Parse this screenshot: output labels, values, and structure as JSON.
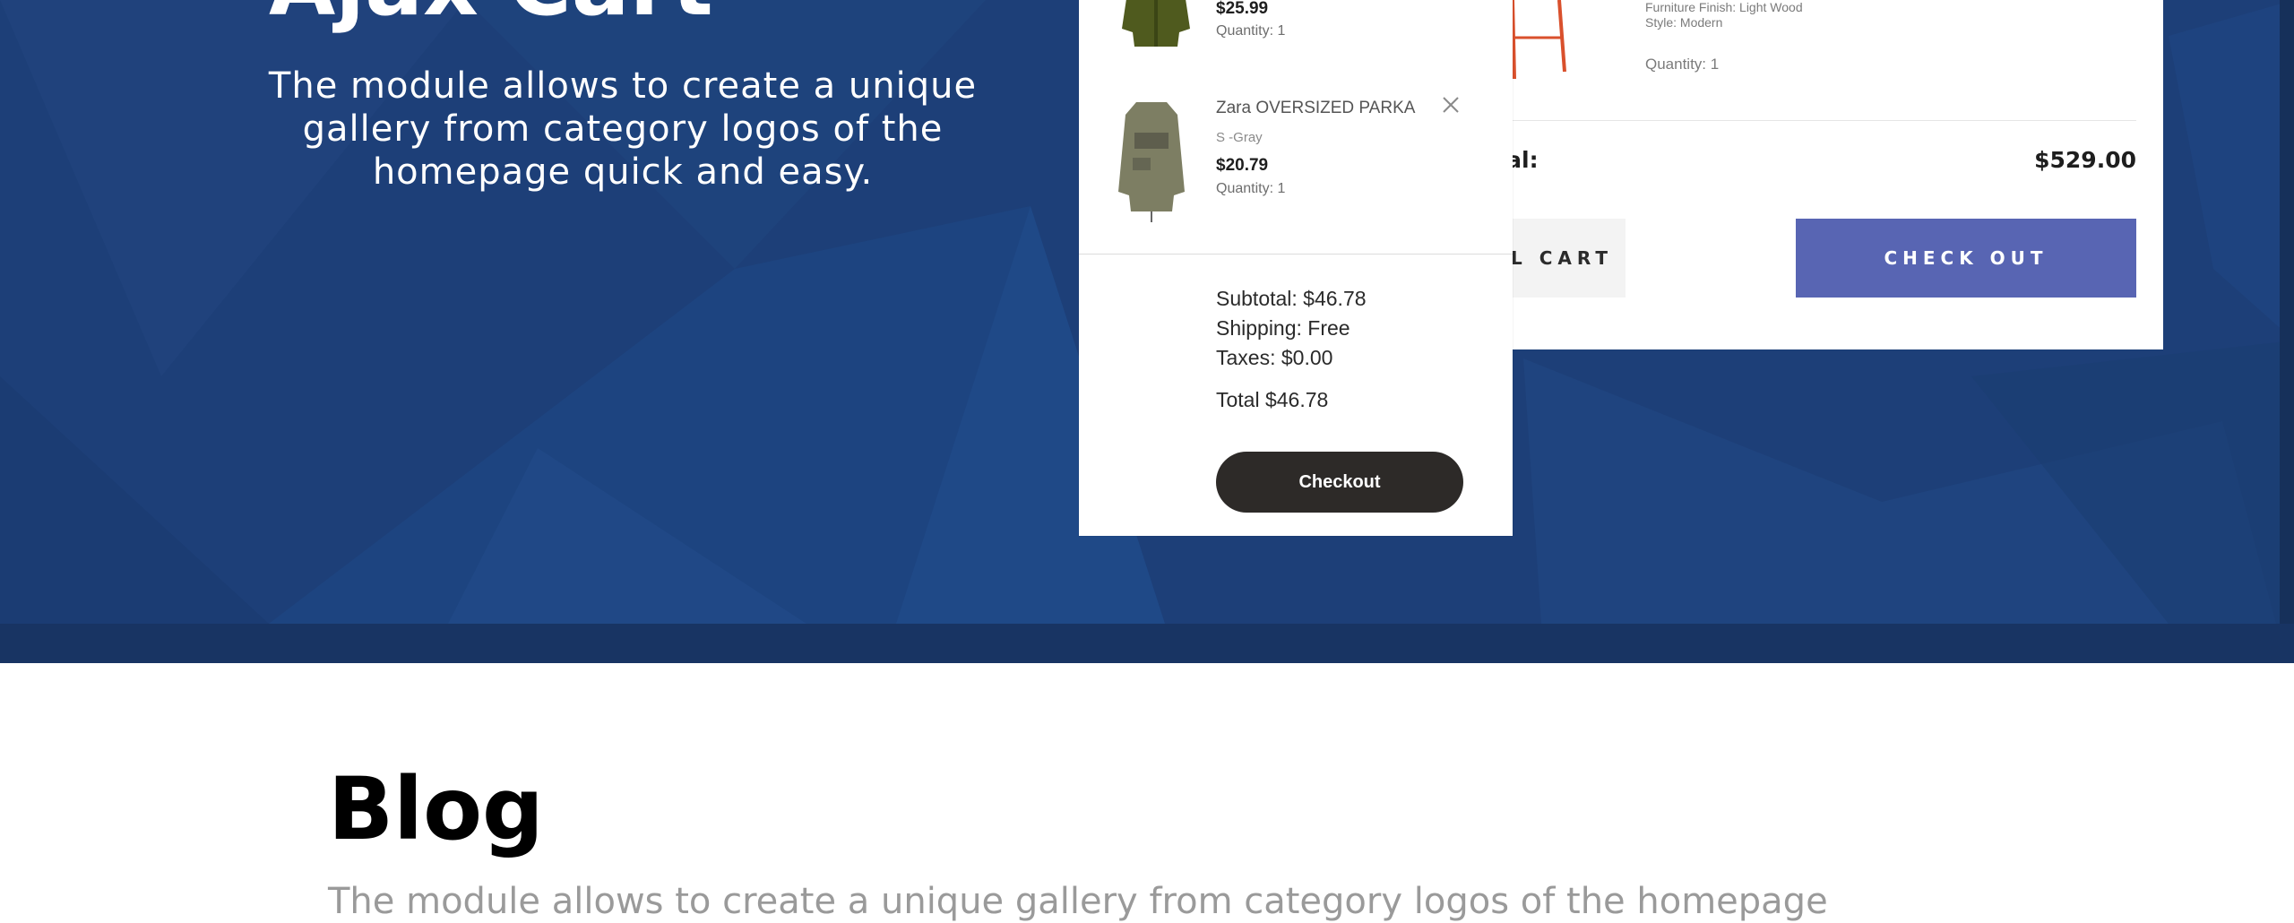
{
  "hero": {
    "title": "Ajax Cart",
    "description": "The module allows to create a unique gallery from category logos of the homepage quick and easy."
  },
  "cart_preview": {
    "product_finish": "Furniture Finish: Light Wood",
    "product_style": "Style: Modern",
    "product_quantity": "Quantity: 1",
    "total_label": "otal:",
    "total_value": "$529.00",
    "view_full_cart_label": "VIEW FULL CART",
    "check_out_label": "CHECK OUT",
    "checkout_button_color": "#5865b3"
  },
  "minicart": {
    "items": [
      {
        "name": "",
        "variant": "",
        "price": "$25.99",
        "quantity": "Quantity: 1",
        "thumb_color": "#4f5a1e"
      },
      {
        "name": "Zara OVERSIZED PARKA",
        "variant": "S -Gray",
        "price": "$20.79",
        "quantity": "Quantity: 1",
        "thumb_color": "#7d7e63"
      }
    ],
    "subtotal": "Subtotal: $46.78",
    "shipping": "Shipping: Free",
    "taxes": "Taxes: $0.00",
    "total": "Total $46.78",
    "checkout_label": "Checkout"
  },
  "blog": {
    "title": "Blog",
    "description": "The module allows to create a unique gallery from category logos of the homepage"
  },
  "colors": {
    "hero_bg": "#1d3f78",
    "hero_band": "#183463"
  }
}
